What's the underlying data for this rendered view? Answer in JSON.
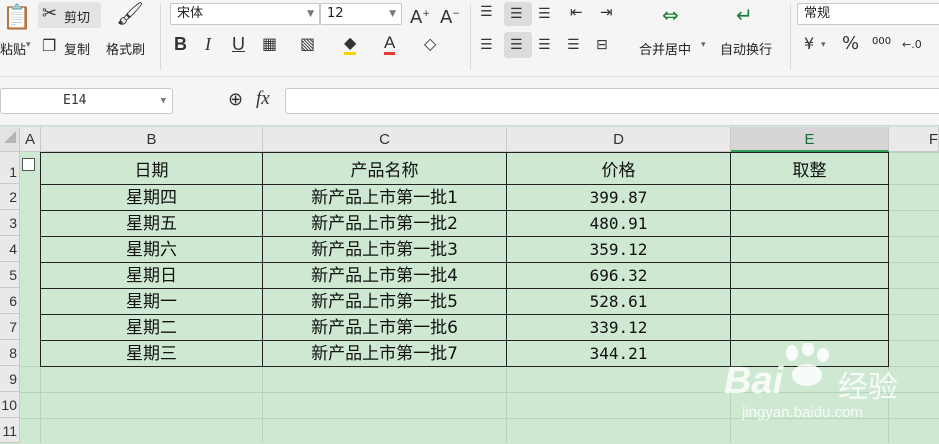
{
  "ribbon": {
    "cut_label": "剪切",
    "paste_label": "粘贴",
    "copy_label": "复制",
    "format_painter_label": "格式刷",
    "font_name": "宋体",
    "font_size": "12",
    "merge_center_label": "合并居中",
    "wrap_text_label": "自动换行",
    "number_format": "常规",
    "percent_symbol": "%",
    "thousands_label": "000"
  },
  "formula_bar": {
    "name_box": "E14",
    "fx_label": "fx",
    "content": ""
  },
  "sheet": {
    "columns": [
      "A",
      "B",
      "C",
      "D",
      "E",
      "F"
    ],
    "rows": [
      "1",
      "2",
      "3",
      "4",
      "5",
      "6",
      "7",
      "8",
      "9",
      "10",
      "11"
    ],
    "headers": [
      "日期",
      "产品名称",
      "价格",
      "取整"
    ],
    "data": [
      [
        "星期四",
        "新产品上市第一批1",
        "399.87",
        ""
      ],
      [
        "星期五",
        "新产品上市第一批2",
        "480.91",
        ""
      ],
      [
        "星期六",
        "新产品上市第一批3",
        "359.12",
        ""
      ],
      [
        "星期日",
        "新产品上市第一批4",
        "696.32",
        ""
      ],
      [
        "星期一",
        "新产品上市第一批5",
        "528.61",
        ""
      ],
      [
        "星期二",
        "新产品上市第一批6",
        "339.12",
        ""
      ],
      [
        "星期三",
        "新产品上市第一批7",
        "344.21",
        ""
      ]
    ]
  },
  "watermark": {
    "brand": "Bai",
    "brand_cn": "经验",
    "url": "jingyan.baidu.com"
  },
  "colors": {
    "sheet_bg": "#cfe8d2",
    "active_col_accent": "#2f9d54"
  }
}
